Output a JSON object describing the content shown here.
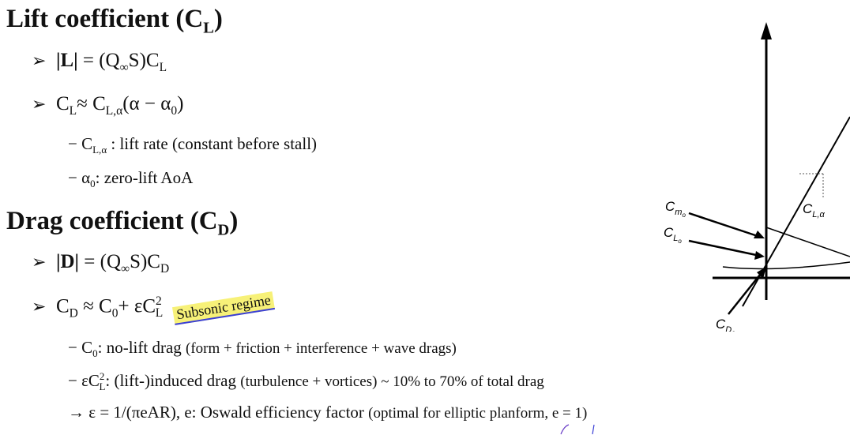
{
  "lift": {
    "heading": "Lift coefficient (C",
    "heading_sub": "L",
    "heading_close": ")",
    "eq1_lhs": "|L|",
    "eq1_rhs": "= (Q",
    "eq1_inf": "∞",
    "eq1_tail": "S)C",
    "eq1_tail_sub": "L",
    "eq2": "C",
    "eq2_sub": "L",
    "eq2_mid": "≈ C",
    "eq2_mid_sub": "L,α",
    "eq2_paren": "(α − α",
    "eq2_paren_sub": "0",
    "eq2_close": ")",
    "sub1_a": "− C",
    "sub1_sub": "L,α",
    "sub1_text": " : lift rate (constant before stall)",
    "sub2_a": "− α",
    "sub2_sub": "0",
    "sub2_text": ": zero-lift AoA"
  },
  "drag": {
    "heading": "Drag coefficient (C",
    "heading_sub": "D",
    "heading_close": ")",
    "eq1_lhs": "|D|",
    "eq1_rhs": "= (Q",
    "eq1_inf": "∞",
    "eq1_tail": "S)C",
    "eq1_tail_sub": "D",
    "eq2_a": "C",
    "eq2_a_sub": "D",
    "eq2_b": "≈ C",
    "eq2_b_sub": "0",
    "eq2_c": "+ εC",
    "eq2_c_sub": "L",
    "eq2_c_sup": "2",
    "highlight": "Subsonic regime",
    "sub1_a": "− C",
    "sub1_sub": "0",
    "sub1_b": ": no-lift drag ",
    "sub1_c": "(form + friction + interference + wave drags)",
    "sub2_a": "− εC",
    "sub2_sub": "L",
    "sub2_sup": "2",
    "sub2_b": ": (lift-)induced drag ",
    "sub2_c": "(turbulence + vortices) ~ 10% to 70% of total drag",
    "sub3_a": "→ ε = 1/(πeAR), e: Oswald efficiency factor ",
    "sub3_b": "(optimal for elliptic planform, e = 1)"
  },
  "diagram": {
    "label_cm0": "C",
    "label_cm0_sub": "m",
    "label_cm0_sub2": "o",
    "label_cl0": "C",
    "label_cl0_sub": "L",
    "label_cl0_sub2": "o",
    "label_cla": "C",
    "label_cla_sub": "L,α",
    "label_cd0": "C",
    "label_cd0_sub": "D",
    "label_cd0_sub2": "o"
  },
  "icons": {
    "bullet": "arrow-bullet-icon"
  },
  "colors": {
    "highlight": "#f7f178",
    "underline": "#3a3fd6"
  }
}
